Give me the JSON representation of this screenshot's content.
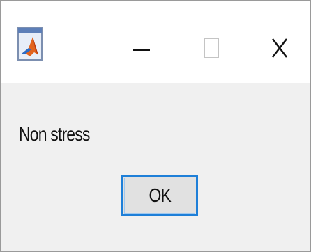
{
  "window": {
    "icon": "matlab-icon",
    "controls": {
      "minimize_icon": "minimize-icon",
      "maximize_icon": "maximize-icon",
      "close_icon": "close-icon"
    }
  },
  "dialog": {
    "message": "Non stress",
    "ok_label": "OK"
  },
  "colors": {
    "titlebar": "#ffffff",
    "body": "#f0f0f0",
    "button_face": "#e1e1e1",
    "focus_border": "#1e7fd8"
  }
}
